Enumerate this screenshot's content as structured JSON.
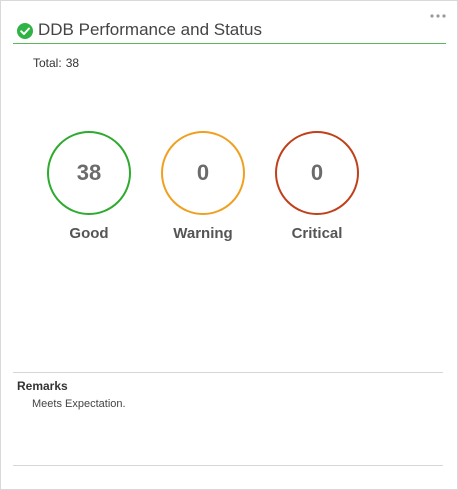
{
  "header": {
    "title": "DDB Performance and Status",
    "status_icon": "check-circle-icon",
    "status_color": "#2fb344",
    "menu_icon": "more-dots-icon"
  },
  "summary": {
    "total_label": "Total:",
    "total_value": "38"
  },
  "stats": [
    {
      "value": "38",
      "label": "Good",
      "color": "#2eaa2e"
    },
    {
      "value": "0",
      "label": "Warning",
      "color": "#f0a020"
    },
    {
      "value": "0",
      "label": "Critical",
      "color": "#c0401c"
    }
  ],
  "remarks": {
    "title": "Remarks",
    "text": "Meets Expectation."
  }
}
